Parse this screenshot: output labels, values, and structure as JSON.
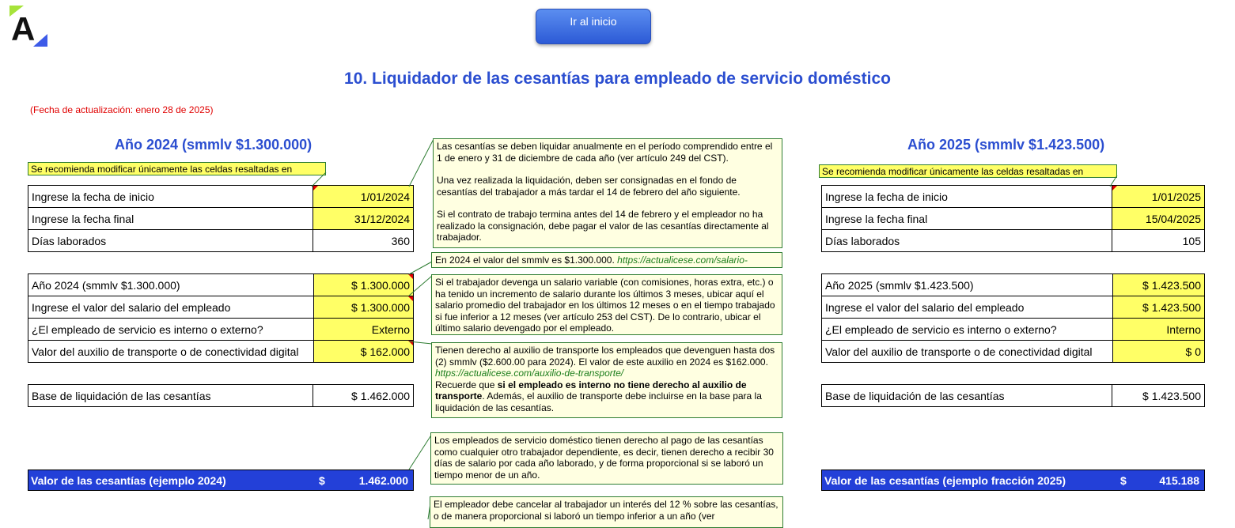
{
  "header": {
    "logo_letter": "A",
    "button_label": "Ir al inicio",
    "title": "10. Liquidador de las cesantías para empleado de servicio doméstico",
    "update_date": "(Fecha de actualización: enero 28 de 2025)"
  },
  "left": {
    "year_title": "Año 2024 (smmlv $1.300.000)",
    "hint": "Se recomienda modificar únicamente las celdas resaltadas en",
    "rows1": [
      {
        "label": "Ingrese la fecha de inicio",
        "value": "1/01/2024"
      },
      {
        "label": "Ingrese la fecha final",
        "value": "31/12/2024"
      },
      {
        "label": "Días laborados",
        "value": "360"
      }
    ],
    "rows2": [
      {
        "label": "Año 2024 (smmlv $1.300.000)",
        "value": "$ 1.300.000"
      },
      {
        "label": "Ingrese el valor del salario del empleado",
        "value": "$ 1.300.000"
      },
      {
        "label": "¿El empleado de servicio es interno o externo?",
        "value": "Externo"
      },
      {
        "label": "Valor del auxilio de transporte o de conectividad digital",
        "value": "$ 162.000"
      }
    ],
    "base": {
      "label": "Base de liquidación de las cesantías",
      "value": "$ 1.462.000"
    },
    "total": {
      "label": "Valor de las cesantías (ejemplo 2024)",
      "currency": "$",
      "value": "1.462.000"
    }
  },
  "right": {
    "year_title": "Año 2025 (smmlv $1.423.500)",
    "hint": "Se recomienda modificar únicamente las celdas resaltadas en",
    "rows1": [
      {
        "label": "Ingrese la fecha de inicio",
        "value": "1/01/2025"
      },
      {
        "label": "Ingrese la fecha final",
        "value": "15/04/2025"
      },
      {
        "label": "Días laborados",
        "value": "105"
      }
    ],
    "rows2": [
      {
        "label": "Año 2025 (smmlv $1.423.500)",
        "value": "$ 1.423.500"
      },
      {
        "label": "Ingrese el valor del salario del empleado",
        "value": "$ 1.423.500"
      },
      {
        "label": "¿El empleado de servicio es interno o externo?",
        "value": "Interno"
      },
      {
        "label": "Valor del auxilio de transporte o de conectividad digital",
        "value": "$ 0"
      }
    ],
    "base": {
      "label": "Base de liquidación de las cesantías",
      "value": "$ 1.423.500"
    },
    "total": {
      "label": "Valor de las cesantías (ejemplo fracción 2025)",
      "currency": "$",
      "value": "415.188"
    }
  },
  "notes": {
    "n1_p1": "Las cesantías se deben liquidar anualmente en el período comprendido entre el 1 de enero y 31 de diciembre de cada año (ver artículo 249 del CST).",
    "n1_p2": "Una vez realizada la liquidación, deben ser consignadas en el fondo de cesantías del trabajador a más tardar el 14 de febrero del año siguiente.",
    "n1_p3": "Si el contrato de trabajo termina antes del 14 de febrero y el empleador no ha realizado la consignación, debe pagar el valor de las cesantías directamente al trabajador.",
    "n2_text": "En 2024 el valor del smmlv es $1.300.000.",
    "n2_link": "https://actualicese.com/salario-",
    "n3": "Si el trabajador devenga un salario variable (con comisiones, horas extra, etc.) o ha tenido un incremento de salario durante los últimos 3 meses, ubicar aquí el salario promedio del trabajador en los últimos 12 meses o en el tiempo trabajado si fue inferior a 12 meses (ver artículo 253 del CST). De lo contrario, ubicar el último salario devengado por el empleado.",
    "n4_p1": "Tienen derecho al auxilio de transporte los empleados que devenguen hasta dos (2) smmlv ($2.600.00 para 2024). El valor de este auxilio en 2024 es $162.000.",
    "n4_link": "https://actualicese.com/auxilio-de-transporte/",
    "n4_p2a": "Recuerde que",
    "n4_p2b": "si el empleado es interno no tiene derecho al auxilio de transporte",
    "n4_p2c": ". Además, el auxilio de transporte debe incluirse en la base para la liquidación de las cesantías.",
    "n5": "Los empleados de servicio doméstico tienen derecho al pago de las cesantías como cualquier otro trabajador dependiente, es decir, tienen derecho a recibir 30 días de salario por cada año laborado, y de forma proporcional si se laboró un tiempo menor de un año.",
    "n6": "El empleador debe cancelar al trabajador un interés del 12 % sobre las cesantías, o de manera proporcional si laboró un tiempo inferior a un año (ver"
  }
}
